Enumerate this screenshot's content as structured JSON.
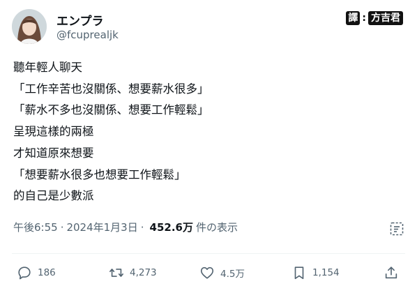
{
  "author": {
    "name": "エンプラ",
    "handle": "@fcuprealjk"
  },
  "watermark": {
    "left": "譯",
    "right": "方吉君"
  },
  "tweet": {
    "lines": [
      "聽年輕人聊天",
      "「工作辛苦也沒關係、想要薪水很多」",
      "「薪水不多也沒關係、想要工作輕鬆」",
      "呈現這樣的兩極",
      "才知道原來想要",
      "「想要薪水很多也想要工作輕鬆」",
      "的自己是少數派"
    ]
  },
  "meta": {
    "time": "午後6:55",
    "separator": "·",
    "date": "2024年1月3日",
    "views_count": "452.6万",
    "views_label": "件の表示"
  },
  "actions": {
    "reply_count": "186",
    "retweet_count": "4,273",
    "like_count": "4.5万",
    "bookmark_count": "1,154"
  },
  "icons": [
    "reply-icon",
    "retweet-icon",
    "like-icon",
    "bookmark-icon",
    "share-icon",
    "views-analytics-icon"
  ],
  "colors": {
    "text": "#0f1419",
    "secondary": "#536471",
    "divider": "#eff3f4"
  }
}
